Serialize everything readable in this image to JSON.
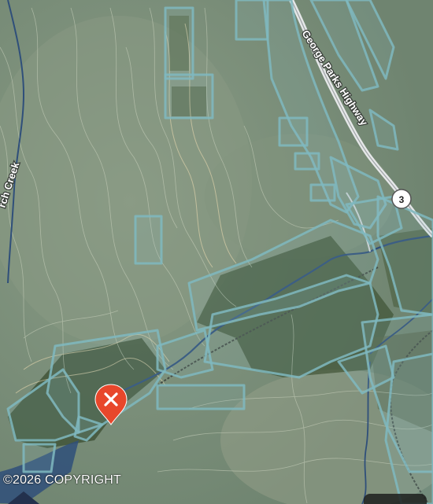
{
  "map": {
    "road_label": "George Parks Highway",
    "route_shield": "3",
    "creek_label": "rch Creek",
    "copyright": "©2026 COPYRIGHT",
    "marker_icon": "close-x-pin-icon",
    "colors": {
      "terrain": "#7c8f7a",
      "parcel_outline": "#7fb8bf",
      "marker": "#e8472b",
      "water": "#2f4f7a",
      "road": "#d8dadb"
    }
  }
}
